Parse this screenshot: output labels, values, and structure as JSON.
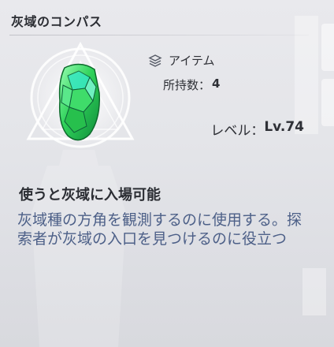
{
  "item": {
    "name": "灰域のコンパス",
    "category": "アイテム",
    "category_icon": "layers-icon",
    "owned_label": "所持数：",
    "owned_count": "4",
    "level_label": "レベル：",
    "level_value": "Lv.74"
  },
  "description": {
    "title": "使うと灰域に入場可能",
    "body": "灰域種の方角を観測するのに使用する。探索者が灰域の入口を見つけるのに役立つ"
  },
  "colors": {
    "accent_text": "#4d6088",
    "gem_green": "#2fd25a",
    "gem_teal": "#38e8c4"
  }
}
